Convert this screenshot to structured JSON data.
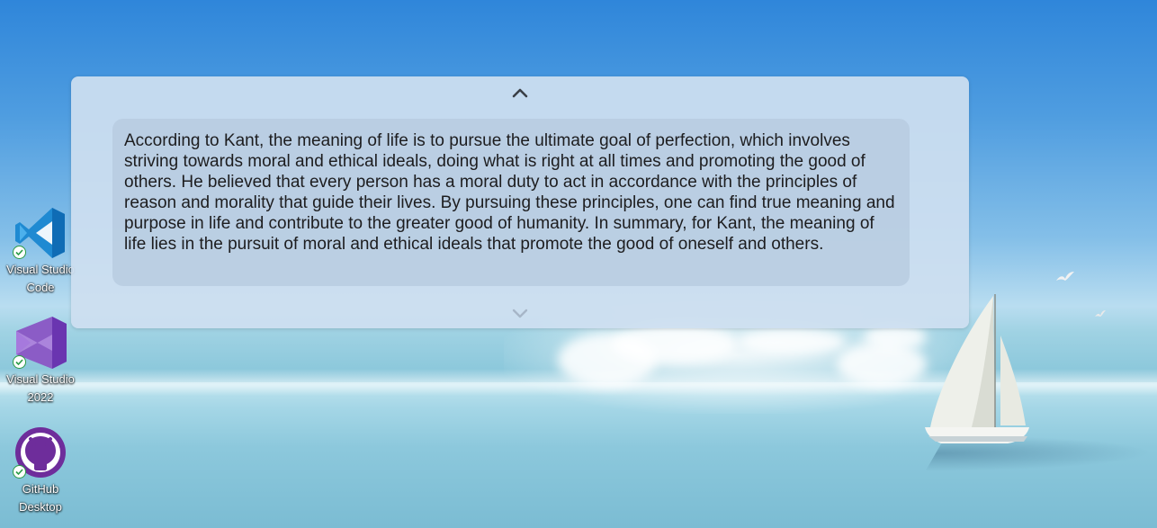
{
  "desktop": {
    "icons": [
      {
        "name": "Visual Studio Code",
        "label_line1": "Visual Studio",
        "label_line2": "Code",
        "icon": "vscode-icon",
        "color": "#1f8ad2"
      },
      {
        "name": "Visual Studio 2022",
        "label_line1": "Visual Studio",
        "label_line2": "2022",
        "icon": "visual-studio-icon",
        "color": "#8b5cc6"
      },
      {
        "name": "GitHub Desktop",
        "label_line1": "GitHub",
        "label_line2": "Desktop",
        "icon": "github-desktop-icon",
        "color": "#6e2d9b"
      }
    ]
  },
  "panel": {
    "collapse_icon": "chevron-up-icon",
    "expand_icon": "chevron-down-icon",
    "answer_text": "According to Kant, the meaning of life is to pursue the ultimate goal of perfection, which involves striving towards moral and ethical ideals, doing what is right at all times and promoting the good of others. He believed that every person has a moral duty to act in accordance with the principles of reason and morality that guide their lives. By pursuing these principles, one can find true meaning and purpose in life and contribute to the greater good of humanity. In summary, for Kant, the meaning of life lies in the pursuit of moral and ethical ideals that promote the good of oneself and others."
  }
}
